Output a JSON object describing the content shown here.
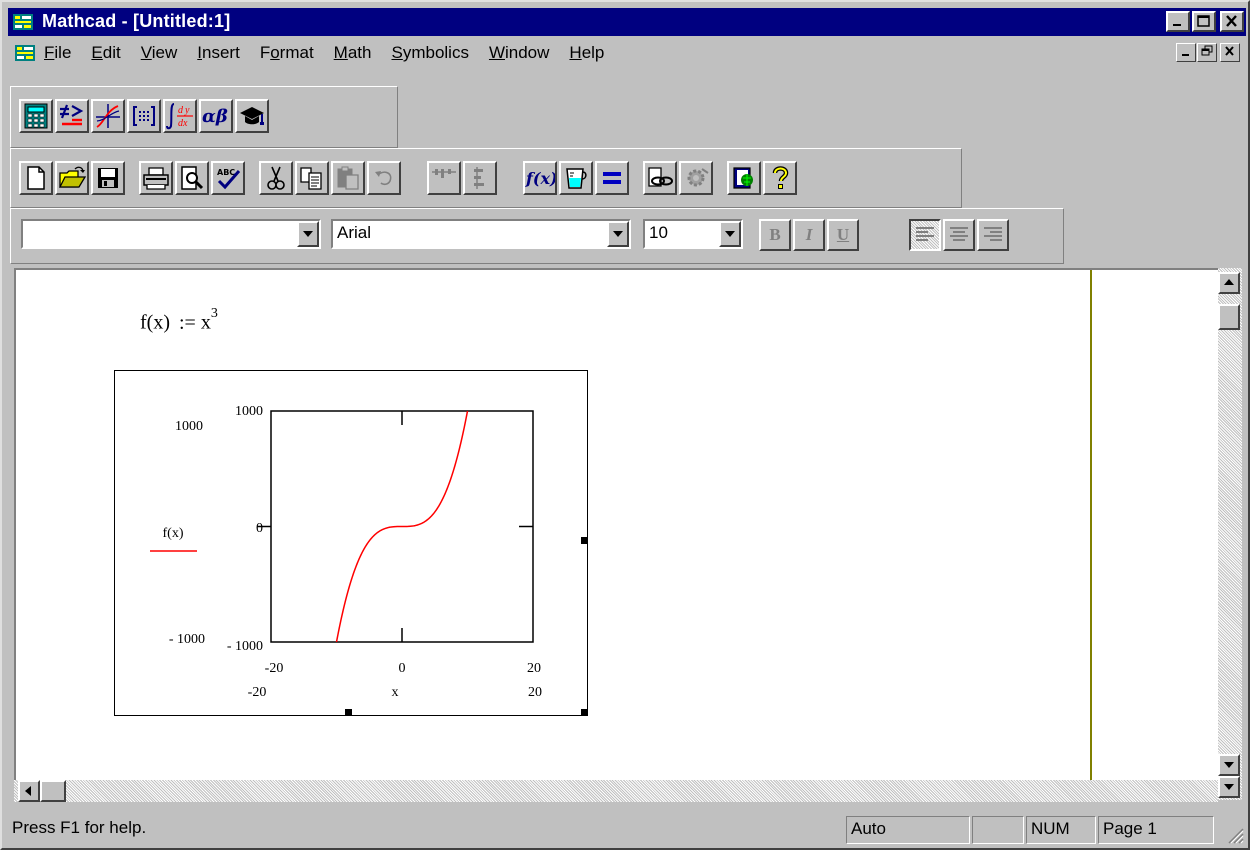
{
  "window": {
    "title": "Mathcad - [Untitled:1]"
  },
  "menubar": {
    "items": [
      {
        "label": "File",
        "key": "F",
        "rest": "ile"
      },
      {
        "label": "Edit",
        "key": "E",
        "rest": "dit"
      },
      {
        "label": "View",
        "key": "V",
        "rest": "iew"
      },
      {
        "label": "Insert",
        "key": "I",
        "rest": "nsert"
      },
      {
        "label": "Format",
        "pre": "F",
        "key": "o",
        "rest": "rmat"
      },
      {
        "label": "Math",
        "key": "M",
        "rest": "ath"
      },
      {
        "label": "Symbolics",
        "key": "S",
        "rest": "ymbolics"
      },
      {
        "label": "Window",
        "key": "W",
        "rest": "indow"
      },
      {
        "label": "Help",
        "key": "H",
        "rest": "elp"
      }
    ]
  },
  "formatbar": {
    "style_value": "",
    "font_value": "Arial",
    "size_value": "10",
    "bold": "B",
    "italic": "I",
    "underline": "U"
  },
  "document": {
    "definition": {
      "lhs": "f(x)",
      "assign": ":=",
      "base": "x",
      "exponent": "3"
    }
  },
  "chart_data": {
    "type": "line",
    "function": "x^3",
    "series": [
      {
        "name": "f(x)",
        "color": "#ff0000",
        "x": [
          -10,
          -9,
          -8,
          -7,
          -6,
          -5,
          -4,
          -3,
          -2,
          -1,
          0,
          1,
          2,
          3,
          4,
          5,
          6,
          7,
          8,
          9,
          10
        ],
        "y": [
          -1000,
          -729,
          -512,
          -343,
          -216,
          -125,
          -64,
          -27,
          -8,
          -1,
          0,
          1,
          8,
          27,
          64,
          125,
          216,
          343,
          512,
          729,
          1000
        ]
      }
    ],
    "xlim": [
      -20,
      20
    ],
    "ylim": [
      -1000,
      1000
    ],
    "xlabel": "x",
    "x_ticks": [
      "-20",
      "0",
      "20"
    ],
    "y_ticks": [
      "1000",
      "0",
      "- 1000"
    ],
    "x_limit_labels": {
      "min": "-20",
      "max": "20"
    },
    "y_limit_labels": {
      "max": "1000",
      "min": "- 1000"
    },
    "legend": {
      "label": "f(x)",
      "placement": "left"
    },
    "grid": false
  },
  "statusbar": {
    "help_text": "Press F1 for help.",
    "mode": "Auto",
    "empty": "",
    "num": "NUM",
    "page": "Page 1"
  }
}
